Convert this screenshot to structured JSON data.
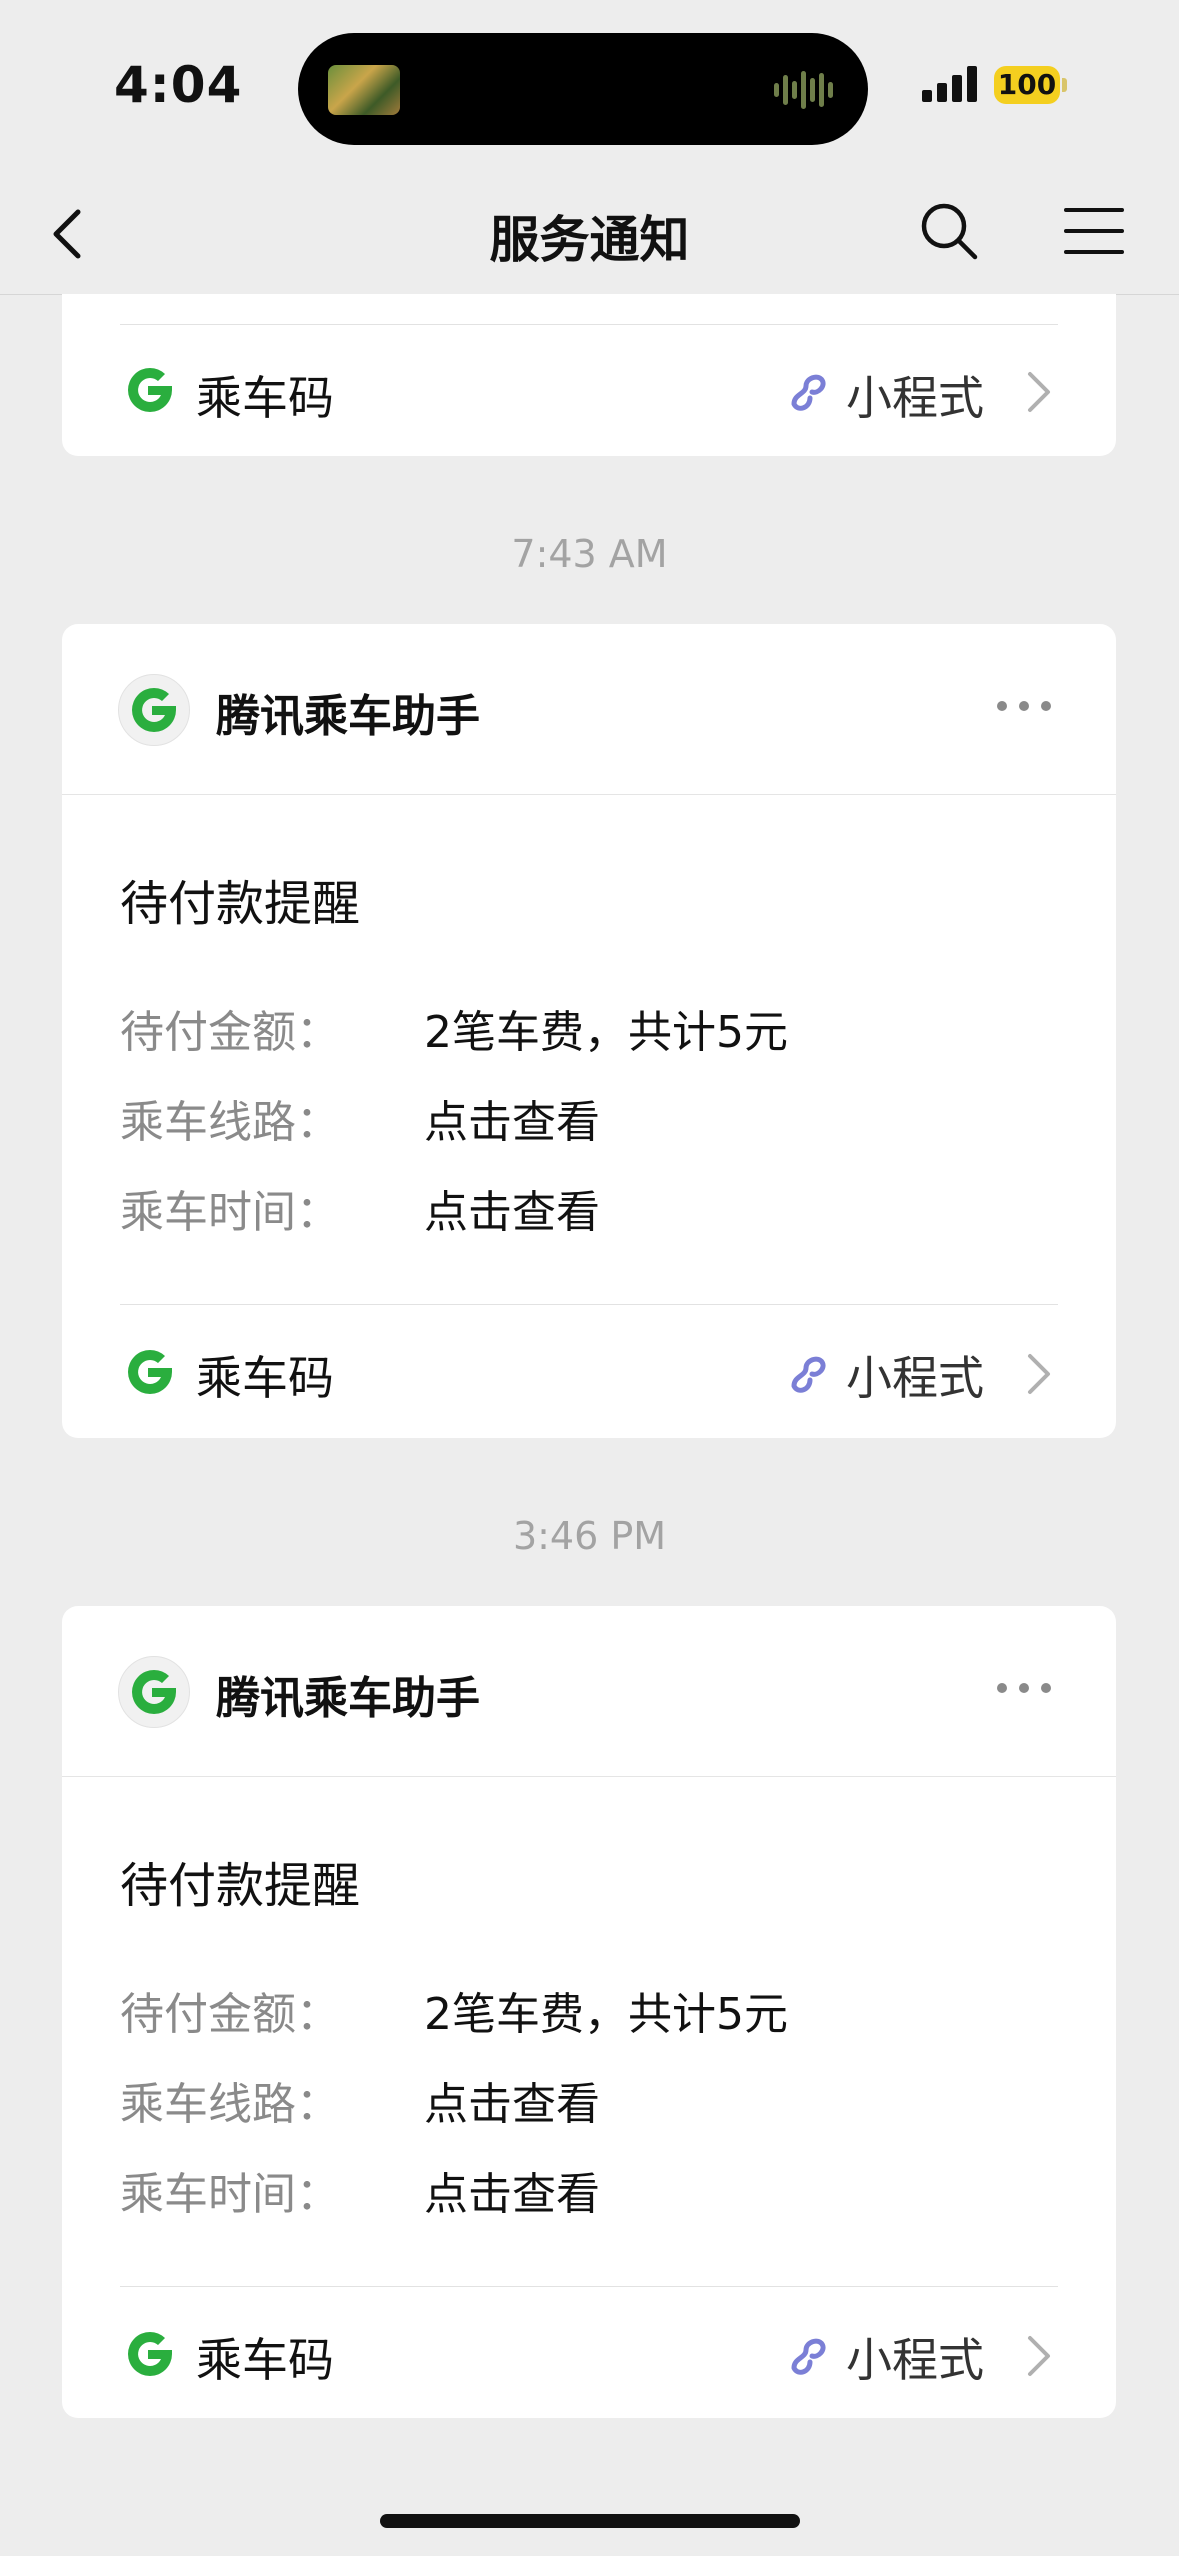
{
  "status_bar": {
    "time": "4:04",
    "battery": "100"
  },
  "nav": {
    "title": "服务通知"
  },
  "top_card": {
    "footer_label": "乘车码",
    "mini_label": "小程式"
  },
  "messages": [
    {
      "timestamp": "7:43 AM",
      "app_name": "腾讯乘车助手",
      "title": "待付款提醒",
      "rows": [
        {
          "label": "待付金额：",
          "value": "2笔车费，共计5元"
        },
        {
          "label": "乘车线路：",
          "value": "点击查看"
        },
        {
          "label": "乘车时间：",
          "value": "点击查看"
        }
      ],
      "footer_label": "乘车码",
      "mini_label": "小程式"
    },
    {
      "timestamp": "3:46 PM",
      "app_name": "腾讯乘车助手",
      "title": "待付款提醒",
      "rows": [
        {
          "label": "待付金额：",
          "value": "2笔车费，共计5元"
        },
        {
          "label": "乘车线路：",
          "value": "点击查看"
        },
        {
          "label": "乘车时间：",
          "value": "点击查看"
        }
      ],
      "footer_label": "乘车码",
      "mini_label": "小程式"
    }
  ],
  "colors": {
    "brand_green": "#2aae3e",
    "mini_program_purple": "#7b7fd6",
    "background": "#ededed"
  }
}
